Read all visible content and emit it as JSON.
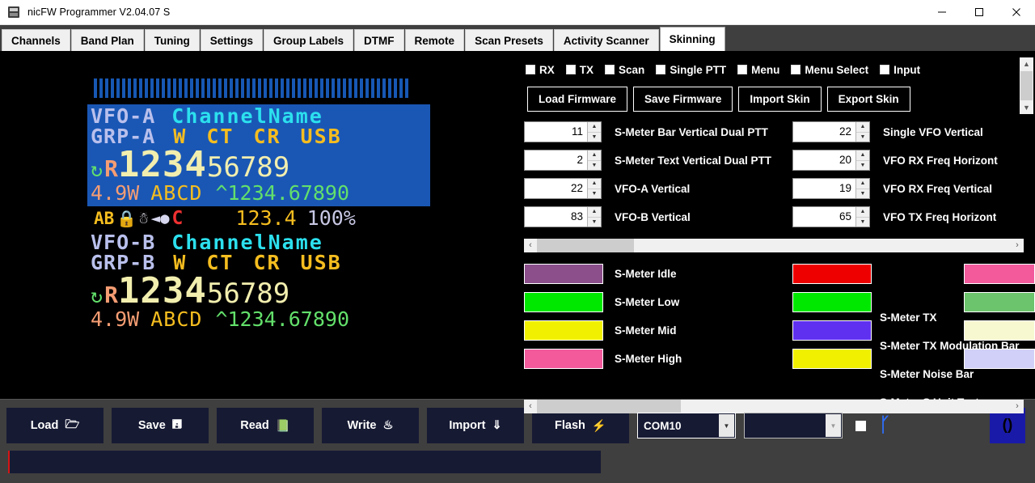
{
  "window": {
    "title": "nicFW Programmer V2.04.07 S",
    "icon": "radio-icon",
    "minimize": "–",
    "maximize": "□",
    "close": "✕"
  },
  "tabs": [
    {
      "label": "Channels",
      "active": false
    },
    {
      "label": "Band Plan",
      "active": false
    },
    {
      "label": "Tuning",
      "active": false
    },
    {
      "label": "Settings",
      "active": false
    },
    {
      "label": "Group Labels",
      "active": false
    },
    {
      "label": "DTMF",
      "active": false
    },
    {
      "label": "Remote",
      "active": false
    },
    {
      "label": "Scan Presets",
      "active": false
    },
    {
      "label": "Activity Scanner",
      "active": false
    },
    {
      "label": "Skinning",
      "active": true
    }
  ],
  "preview": {
    "smeter_bar_count": 56,
    "smeter_bar_color": "#1758b4",
    "vfo_a": {
      "background": "#1a57b5",
      "vfo_label": "VFO-A",
      "channel_name": "ChannelName",
      "group_label": "GRP-A",
      "mode_w": "W",
      "mode_ct": "CT",
      "mode_cr": "CR",
      "mode_sb": "USB",
      "reverse_icon": "↻",
      "r_indicator": "R",
      "freq_big": "1234",
      "freq_small": "56789",
      "power": "4.9W",
      "abcd": "ABCD",
      "tx_freq": "^1234.67890"
    },
    "status": {
      "ab_icon": "AB",
      "lock_icon": "lock",
      "bt_icon": "bluetooth",
      "speaker_icon": "speaker",
      "c_icon": "C",
      "voltage": "123.4",
      "battery": "100%"
    },
    "vfo_b": {
      "background": "#000000",
      "vfo_label": "VFO-B",
      "channel_name": "ChannelName",
      "group_label": "GRP-B",
      "mode_w": "W",
      "mode_ct": "CT",
      "mode_cr": "CR",
      "mode_sb": "USB",
      "reverse_icon": "↻",
      "r_indicator": "R",
      "freq_big": "1234",
      "freq_small": "56789",
      "power": "4.9W",
      "abcd": "ABCD",
      "tx_freq": "^1234.67890"
    }
  },
  "controls": {
    "checkboxes": [
      {
        "label": "RX",
        "checked": false
      },
      {
        "label": "TX",
        "checked": false
      },
      {
        "label": "Scan",
        "checked": false
      },
      {
        "label": "Single PTT",
        "checked": false
      },
      {
        "label": "Menu",
        "checked": false
      },
      {
        "label": "Menu Select",
        "checked": false
      },
      {
        "label": "Input",
        "checked": false
      }
    ],
    "buttons": [
      {
        "label": "Load Firmware"
      },
      {
        "label": "Save Firmware"
      },
      {
        "label": "Import Skin"
      },
      {
        "label": "Export Skin"
      }
    ],
    "spinners": [
      {
        "value": "11",
        "label": "S-Meter Bar Vertical Dual PTT"
      },
      {
        "value": "22",
        "label": "Single VFO Vertical"
      },
      {
        "value": "2",
        "label": "S-Meter Text Vertical Dual PTT"
      },
      {
        "value": "20",
        "label": "VFO RX Freq Horizont"
      },
      {
        "value": "22",
        "label": "VFO-A Vertical"
      },
      {
        "value": "19",
        "label": "VFO RX Freq Vertical"
      },
      {
        "value": "83",
        "label": "VFO-B Vertical"
      },
      {
        "value": "65",
        "label": "VFO TX Freq Horizont"
      }
    ],
    "colors": [
      {
        "swatch": "#8c4f8c",
        "label": "S-Meter Idle",
        "swatch2": "#ee0000",
        "label2": "S-Meter TX",
        "swatch3": "#f25a9c"
      },
      {
        "swatch": "#00e800",
        "label": "S-Meter Low",
        "swatch2": "#00e800",
        "label2": "S-Meter TX Modulation Bar",
        "swatch3": "#6cc46c"
      },
      {
        "swatch": "#f0f000",
        "label": "S-Meter Mid",
        "swatch2": "#6030f0",
        "label2": "S-Meter Noise Bar",
        "swatch3": "#f8f8d0"
      },
      {
        "swatch": "#f25a9c",
        "label": "S-Meter High",
        "swatch2": "#f0f000",
        "label2": "S-Meter S Unit Text",
        "swatch3": "#d0d0f8"
      }
    ],
    "scroll_left_arrow": "‹",
    "scroll_right_arrow": "›",
    "scroll_up_arrow": "︿",
    "scroll_down_arrow": "﹀"
  },
  "toolbar": {
    "buttons": [
      {
        "label": "Load",
        "icon": "folder-icon",
        "glyph": "🗁"
      },
      {
        "label": "Save",
        "icon": "floppy-icon",
        "glyph": "🖫"
      },
      {
        "label": "Read",
        "icon": "book-icon",
        "glyph": "⟦⟧"
      },
      {
        "label": "Write",
        "icon": "flame-icon",
        "glyph": "⛆"
      },
      {
        "label": "Import",
        "icon": "down-arrow-icon",
        "glyph": "⇓"
      },
      {
        "label": "Flash",
        "icon": "lightning-icon",
        "glyph": "⚡"
      }
    ],
    "port_select": "COM10",
    "second_select": "",
    "bt_checkbox": false,
    "bt_icon": "bluetooth-icon",
    "console_button": "()"
  },
  "statusbar": {
    "text": ""
  }
}
